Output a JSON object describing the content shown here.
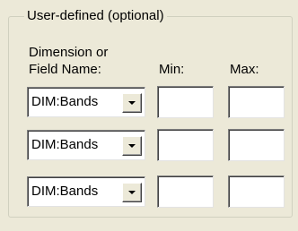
{
  "group": {
    "title": "User-defined (optional)"
  },
  "headers": {
    "field_line1": "Dimension or",
    "field_line2": "Field Name:",
    "min": "Min:",
    "max": "Max:"
  },
  "rows": [
    {
      "field": "DIM:Bands",
      "min": "",
      "max": ""
    },
    {
      "field": "DIM:Bands",
      "min": "",
      "max": ""
    },
    {
      "field": "DIM:Bands",
      "min": "",
      "max": ""
    }
  ],
  "icons": {
    "dropdown": "chevron-down-icon"
  }
}
